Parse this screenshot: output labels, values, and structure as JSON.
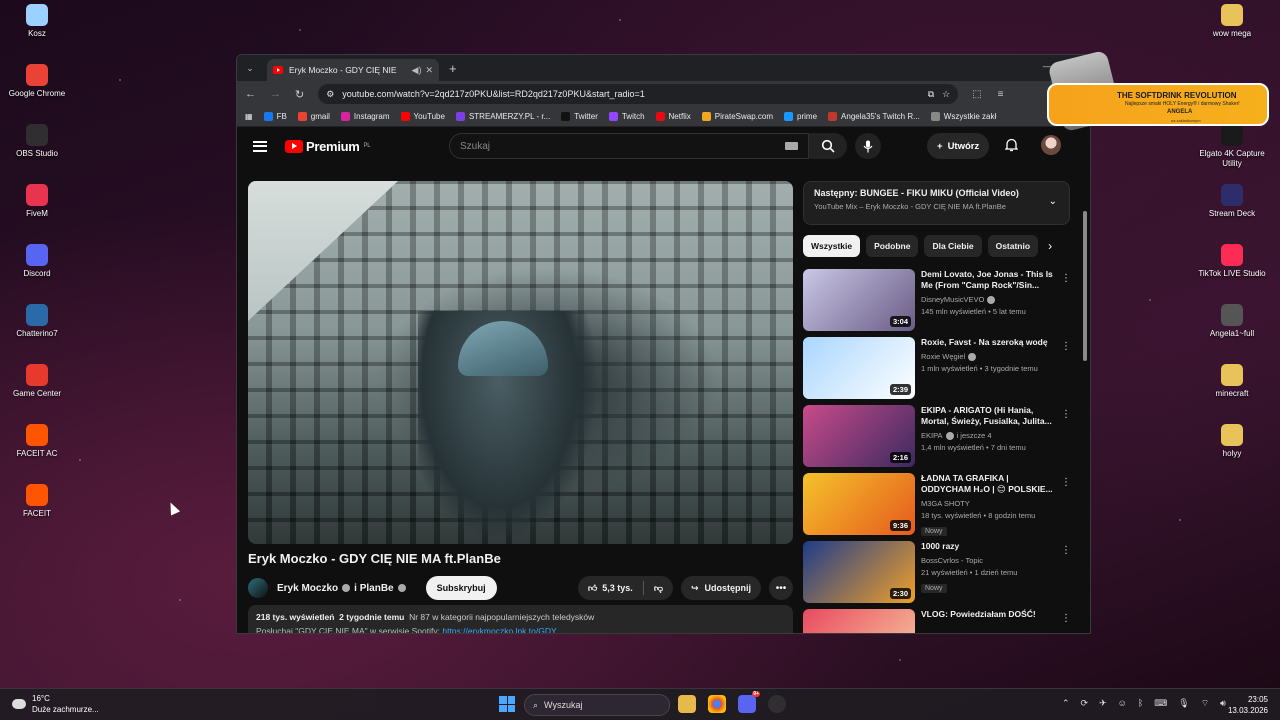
{
  "desktop": {
    "left_icons": [
      {
        "label": "Kosz",
        "icon": "recycle-bin-icon",
        "color": "#9bd0ff"
      },
      {
        "label": "Google Chrome",
        "icon": "chrome-icon",
        "color": "#ea4335"
      },
      {
        "label": "OBS Studio",
        "icon": "obs-icon",
        "color": "#302e31"
      },
      {
        "label": "FiveM",
        "icon": "fivem-icon",
        "color": "#e8344e"
      },
      {
        "label": "Discord",
        "icon": "discord-icon",
        "color": "#5865f2"
      },
      {
        "label": "Chatterino7",
        "icon": "chatterino-icon",
        "color": "#2a6aa8"
      },
      {
        "label": "Game Center",
        "icon": "game-center-icon",
        "color": "#e83a2c"
      },
      {
        "label": "FACEIT AC",
        "icon": "faceit-ac-icon",
        "color": "#ff5500"
      },
      {
        "label": "FACEIT",
        "icon": "faceit-icon",
        "color": "#ff5500"
      }
    ],
    "right_icons": [
      {
        "label": "wow mega",
        "icon": "folder-icon",
        "color": "#e8c35a"
      },
      {
        "label": "Elgato 4K Capture Utility",
        "icon": "elgato-icon",
        "color": "#1a1a1a"
      },
      {
        "label": "Stream Deck",
        "icon": "stream-deck-icon",
        "color": "#2d2d6b"
      },
      {
        "label": "TikTok LIVE Studio",
        "icon": "tiktok-icon",
        "color": "#fe2c55"
      },
      {
        "label": "Angela1~full",
        "icon": "file-icon",
        "color": "#555555"
      },
      {
        "label": "minecraft",
        "icon": "folder-icon",
        "color": "#e8c35a"
      },
      {
        "label": "holyy",
        "icon": "folder-icon",
        "color": "#e8c35a"
      }
    ]
  },
  "browser": {
    "tab_title": "Eryk Moczko - GDY CIĘ NIE",
    "url": "youtube.com/watch?v=2qd217z0PKU&list=RD2qd217z0PKU&start_radio=1",
    "bookmarks": [
      {
        "label": "FB",
        "color": "#1877f2"
      },
      {
        "label": "gmail",
        "color": "#ea4335"
      },
      {
        "label": "Instagram",
        "color": "#d6249f"
      },
      {
        "label": "YouTube",
        "color": "#ff0000"
      },
      {
        "label": "STREAMERZY.PL - r...",
        "color": "#7b3fe4"
      },
      {
        "label": "Twitter",
        "color": "#111111"
      },
      {
        "label": "Twitch",
        "color": "#9146ff"
      },
      {
        "label": "Netflix",
        "color": "#e50914"
      },
      {
        "label": "PirateSwap.com",
        "color": "#f2a81d"
      },
      {
        "label": "prime",
        "color": "#1a98ff"
      },
      {
        "label": "Angela35's Twitch R...",
        "color": "#c0392b"
      },
      {
        "label": "Wszystkie zakł",
        "color": "#888888"
      }
    ]
  },
  "youtube": {
    "logo": "Premium",
    "logo_region": "PL",
    "search_placeholder": "Szukaj",
    "create_label": "Utwórz",
    "video_title": "Eryk Moczko - GDY CIĘ NIE MA ft.PlanBe",
    "channel_name": "Eryk Moczko",
    "channel_and": "i PlanBe",
    "subscribe_label": "Subskrybuj",
    "likes": "5,3 tys.",
    "share_label": "Udostępnij",
    "desc_views": "218 tys. wyświetleń",
    "desc_date": "2 tygodnie temu",
    "desc_rank": "Nr 87 w kategorii najpopularniejszych teledysków",
    "desc_line2": "Posłuchaj \"GDY CIĘ NIE MA\" w serwisie Spotify:",
    "desc_link": "https://erykmoczko.lnk.to/GDY...",
    "up_next_title": "Następny: BUNGEE - FIKU MIKU (Official Video)",
    "up_next_sub": "YouTube Mix – Eryk Moczko - GDY CIĘ NIE MA ft.PlanBe",
    "chips": [
      "Wszystkie",
      "Podobne",
      "Dla Ciebie",
      "Ostatnio"
    ],
    "recs": [
      {
        "title": "Demi Lovato, Joe Jonas - This Is Me (From \"Camp Rock\"/Sin...",
        "channel": "DisneyMusicVEVO",
        "verified": true,
        "meta": "145 mln wyświetleń • 5 lat temu",
        "duration": "3:04",
        "isnew": "",
        "color1": "#c9c7e6",
        "color2": "#6a5c86"
      },
      {
        "title": "Roxie, Favst - Na szeroką wodę",
        "channel": "Roxie Węgiel",
        "verified": true,
        "meta": "1 mln wyświetleń • 3 tygodnie temu",
        "duration": "2:39",
        "isnew": "",
        "color1": "#a9d6ff",
        "color2": "#ffffff"
      },
      {
        "title": "EKIPA - ARIGATO (Hi Hania, Mortal, Świeży, Fusialka, Julita...",
        "channel": "EKIPA",
        "verified": true,
        "channel_extra": "i jeszcze 4",
        "meta": "1,4 mln wyświetleń • 7 dni temu",
        "duration": "2:16",
        "isnew": "",
        "color1": "#c84b8a",
        "color2": "#3b2a60"
      },
      {
        "title": "ŁADNA TA GRAFIKA | ODDYCHAM H₂O | 😊 POLSKIE...",
        "channel": "M3GA SHOTY",
        "verified": false,
        "meta": "18 tys. wyświetleń • 8 godzin temu",
        "duration": "9:36",
        "isnew": "Nowy",
        "color1": "#f4c22b",
        "color2": "#e65a1e"
      },
      {
        "title": "1000 razy",
        "channel": "BossCvrlos - Topic",
        "verified": false,
        "meta": "21 wyświetleń • 1 dzień temu",
        "duration": "2:30",
        "isnew": "Nowy",
        "color1": "#1e3c8a",
        "color2": "#f0a02a"
      },
      {
        "title": "VLOG: Powiedziałam DOŚĆ!",
        "channel": "",
        "verified": false,
        "meta": "",
        "duration": "",
        "isnew": "",
        "color1": "#e84a5f",
        "color2": "#f7c9a0"
      }
    ]
  },
  "ad": {
    "headline": "THE SOFTDRINK REVOLUTION",
    "sub": "Najlepsze smaki HOLY Energy® i darmowy Shaker!",
    "name": "ANGELA",
    "tiny": "na zakładkowym"
  },
  "taskbar": {
    "temp": "16°C",
    "weather": "Duże zachmurze...",
    "search_label": "Wyszukaj",
    "time": "23:05",
    "date": "13.03.2026",
    "discord_badge": "9+"
  }
}
